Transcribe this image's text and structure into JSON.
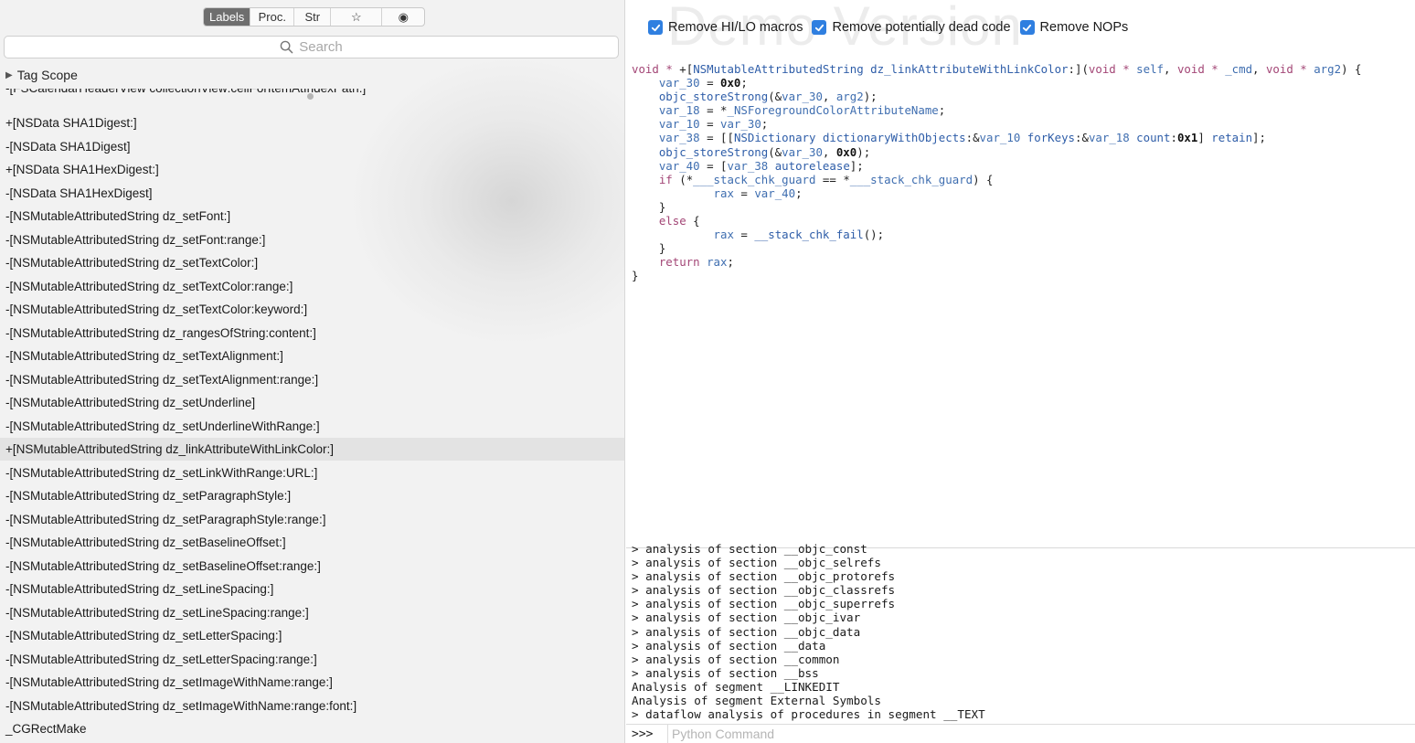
{
  "sidebar": {
    "segments": [
      "Labels",
      "Proc.",
      "Str",
      "☆",
      "◉"
    ],
    "search_placeholder": "Search",
    "tag_scope_label": "Tag Scope",
    "truncated_row": "-[FSCalendarHeaderView collectionView:cellForItemAtIndexPath:]",
    "labels": [
      "+[NSData SHA1Digest:]",
      "-[NSData SHA1Digest]",
      "+[NSData SHA1HexDigest:]",
      "-[NSData SHA1HexDigest]",
      "-[NSMutableAttributedString dz_setFont:]",
      "-[NSMutableAttributedString dz_setFont:range:]",
      "-[NSMutableAttributedString dz_setTextColor:]",
      "-[NSMutableAttributedString dz_setTextColor:range:]",
      "-[NSMutableAttributedString dz_setTextColor:keyword:]",
      "-[NSMutableAttributedString dz_rangesOfString:content:]",
      "-[NSMutableAttributedString dz_setTextAlignment:]",
      "-[NSMutableAttributedString dz_setTextAlignment:range:]",
      "-[NSMutableAttributedString dz_setUnderline]",
      "-[NSMutableAttributedString dz_setUnderlineWithRange:]",
      "+[NSMutableAttributedString dz_linkAttributeWithLinkColor:]",
      "-[NSMutableAttributedString dz_setLinkWithRange:URL:]",
      "-[NSMutableAttributedString dz_setParagraphStyle:]",
      "-[NSMutableAttributedString dz_setParagraphStyle:range:]",
      "-[NSMutableAttributedString dz_setBaselineOffset:]",
      "-[NSMutableAttributedString dz_setBaselineOffset:range:]",
      "-[NSMutableAttributedString dz_setLineSpacing:]",
      "-[NSMutableAttributedString dz_setLineSpacing:range:]",
      "-[NSMutableAttributedString dz_setLetterSpacing:]",
      "-[NSMutableAttributedString dz_setLetterSpacing:range:]",
      "-[NSMutableAttributedString dz_setImageWithName:range:]",
      "-[NSMutableAttributedString dz_setImageWithName:range:font:]",
      "_CGRectMake"
    ],
    "selected_label": "+[NSMutableAttributedString dz_linkAttributeWithLinkColor:]"
  },
  "editor": {
    "watermark": "Demo Version",
    "options": [
      {
        "label": "Remove HI/LO macros",
        "checked": true
      },
      {
        "label": "Remove potentially dead code",
        "checked": true
      },
      {
        "label": "Remove NOPs",
        "checked": true
      }
    ],
    "code_lines": [
      "void * +[NSMutableAttributedString dz_linkAttributeWithLinkColor:](void * self, void * _cmd, void * arg2) {",
      "    var_30 = 0x0;",
      "    objc_storeStrong(&var_30, arg2);",
      "    var_18 = *_NSForegroundColorAttributeName;",
      "    var_10 = var_30;",
      "    var_38 = [[NSDictionary dictionaryWithObjects:&var_10 forKeys:&var_18 count:0x1] retain];",
      "    objc_storeStrong(&var_30, 0x0);",
      "    var_40 = [var_38 autorelease];",
      "    if (*___stack_chk_guard == *___stack_chk_guard) {",
      "            rax = var_40;",
      "    }",
      "    else {",
      "            rax = __stack_chk_fail();",
      "    }",
      "    return rax;",
      "}"
    ]
  },
  "console": {
    "log_lines": [
      "> analysis of section __objc_const",
      "> analysis of section __objc_selrefs",
      "> analysis of section __objc_protorefs",
      "> analysis of section __objc_classrefs",
      "> analysis of section __objc_superrefs",
      "> analysis of section __objc_ivar",
      "> analysis of section __objc_data",
      "> analysis of section __data",
      "> analysis of section __common",
      "> analysis of section __bss",
      "Analysis of segment __LINKEDIT",
      "Analysis of segment External Symbols",
      "> dataflow analysis of procedures in segment __TEXT"
    ],
    "prompt": ">>>",
    "input_placeholder": "Python Command",
    "input_value": ""
  },
  "colors": {
    "accent": "#2f7fe0",
    "keyword": "#a34676",
    "function": "#2e5da8",
    "selected_row": "#e3e3e3"
  }
}
